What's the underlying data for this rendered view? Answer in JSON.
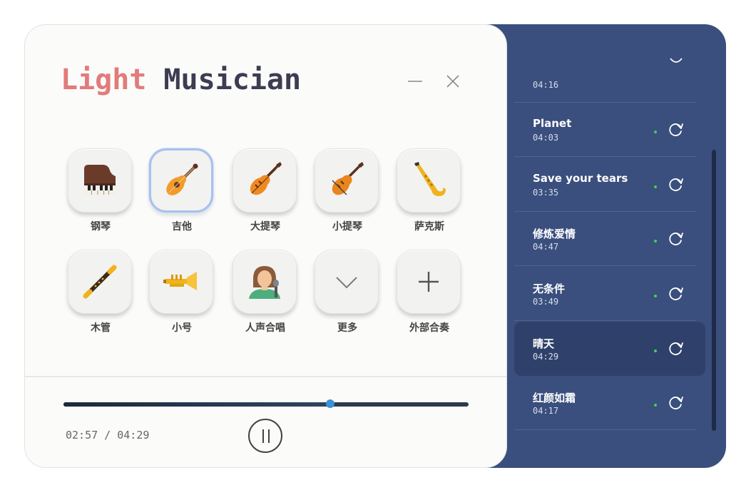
{
  "app": {
    "title_part1": "Light",
    "title_part2": "Musician"
  },
  "window_controls": {
    "minimize_icon": "minimize-icon",
    "close_icon": "close-icon"
  },
  "instruments": [
    {
      "label": "钢琴",
      "icon": "piano-icon",
      "selected": false
    },
    {
      "label": "吉他",
      "icon": "guitar-icon",
      "selected": true
    },
    {
      "label": "大提琴",
      "icon": "cello-icon",
      "selected": false
    },
    {
      "label": "小提琴",
      "icon": "violin-icon",
      "selected": false
    },
    {
      "label": "萨克斯",
      "icon": "saxophone-icon",
      "selected": false
    },
    {
      "label": "木管",
      "icon": "flute-icon",
      "selected": false
    },
    {
      "label": "小号",
      "icon": "trumpet-icon",
      "selected": false
    },
    {
      "label": "人声合唱",
      "icon": "singer-icon",
      "selected": false
    },
    {
      "label": "更多",
      "icon": "chevron-down-icon",
      "selected": false
    },
    {
      "label": "外部合奏",
      "icon": "plus-icon",
      "selected": false
    }
  ],
  "player": {
    "time_readout": "02:57 / 04:29",
    "progress_fraction": 0.658,
    "pause_icon": "pause-icon"
  },
  "playlist": {
    "songs": [
      {
        "name": "",
        "duration": "04:16",
        "active": false
      },
      {
        "name": "Planet",
        "duration": "04:03",
        "active": false
      },
      {
        "name": "Save your tears",
        "duration": "03:35",
        "active": false
      },
      {
        "name": "修炼爱情",
        "duration": "04:47",
        "active": false
      },
      {
        "name": "无条件",
        "duration": "03:49",
        "active": false
      },
      {
        "name": "晴天",
        "duration": "04:29",
        "active": true
      },
      {
        "name": "红颜如霜",
        "duration": "04:17",
        "active": false
      }
    ],
    "status_dot_color": "#3ad35c",
    "item_icon": "refresh-icon"
  },
  "colors": {
    "title_light": "#e27b7b",
    "title_musician": "#3c3d52",
    "panel_blue": "#3a4f7d",
    "active_row": "#2f416a",
    "selection_ring": "#a9c1ec",
    "progress_knob": "#3a91d6"
  }
}
